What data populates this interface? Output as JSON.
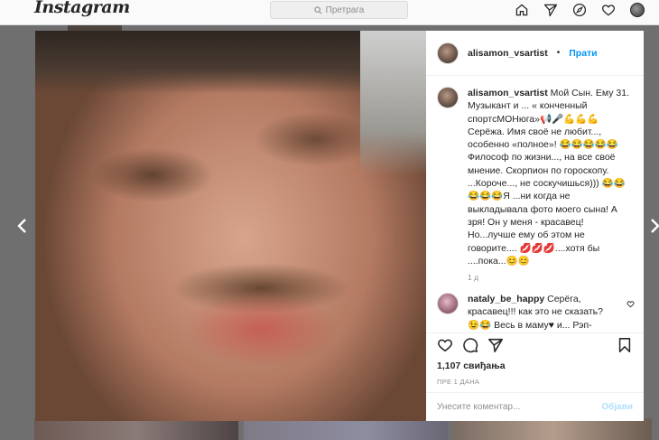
{
  "nav": {
    "logo": "Instagram",
    "search_placeholder": "Претрага",
    "icons": [
      "home-icon",
      "direct-icon",
      "explore-icon",
      "heart-icon",
      "profile-avatar"
    ]
  },
  "post": {
    "username": "alisamon_vsartist",
    "separator": "•",
    "follow_label": "Прати",
    "caption": "Мой Сын. Ему 31. Музыкант и ... « конченный спортсМОНюга»📢🎤💪💪💪 Серёжа. Имя своё не любит..., особенно «полное»! 😂😂😂😂😂 Философ по жизни..., на все своё мнение. Скорпион по гороскопу. ...Короче..., не соскучишься))) 😂😂😂😂😂Я ...ни когда не выкладывала фото моего сына! А зря! Он у меня - красавец! Но...лучше ему об этом не говорите.... 💋💋💋....хотя бы ....пока...😊😊",
    "caption_time": "1 д",
    "comment2_user": "nataly_be_happy",
    "comment2_text": "Серёга, красавец!!! как это не сказать? 😉😂 Весь в маму♥ и... Рэп-",
    "likes": "1,107 свиђања",
    "posted": "ПРЕ 1 ДАНА",
    "add_comment_placeholder": "Унесите коментар...",
    "post_label": "Објави"
  },
  "colors": {
    "accent": "#0095f6",
    "post_disabled": "#b2dffc",
    "text": "#262626",
    "muted": "#8e8e8e"
  }
}
